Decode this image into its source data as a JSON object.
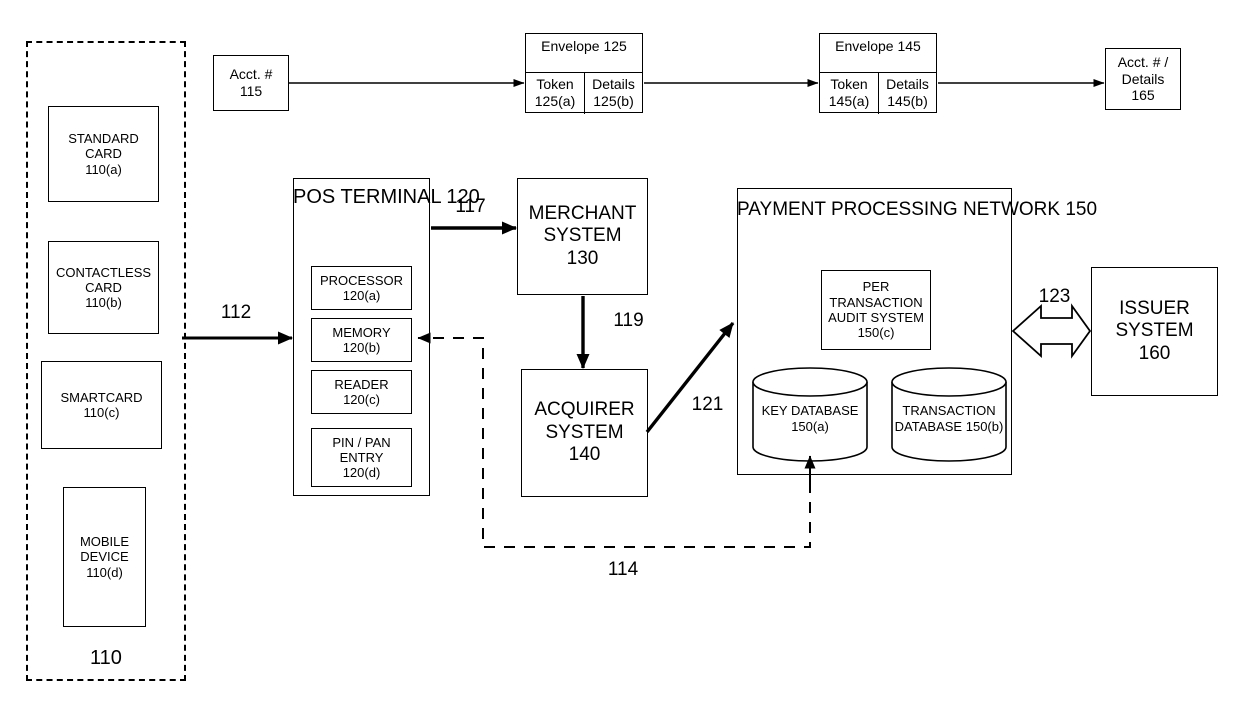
{
  "figure": {
    "group_110": {
      "label": "110",
      "items": [
        {
          "lines": [
            "STANDARD",
            "CARD",
            "110(a)"
          ]
        },
        {
          "lines": [
            "CONTACTLESS",
            "CARD",
            "110(b)"
          ]
        },
        {
          "lines": [
            "SMARTCARD",
            "110(c)"
          ]
        },
        {
          "lines": [
            "MOBILE",
            "DEVICE",
            "110(d)"
          ]
        }
      ]
    },
    "acct_start": {
      "lines": [
        "Acct. #",
        "115"
      ]
    },
    "envelope_125": {
      "title": "Envelope",
      "number": "125",
      "cells": [
        {
          "name": "Token",
          "ref": "125(a)"
        },
        {
          "name": "Details",
          "ref": "125(b)"
        }
      ]
    },
    "envelope_145": {
      "title": "Envelope",
      "number": "145",
      "cells": [
        {
          "name": "Token",
          "ref": "145(a)"
        },
        {
          "name": "Details",
          "ref": "145(b)"
        }
      ]
    },
    "acct_end": {
      "lines": [
        "Acct. # /",
        "Details",
        "165"
      ]
    },
    "pos_terminal": {
      "title_line1": "POS",
      "title_line2": "TERMINAL",
      "number": "120",
      "components": [
        {
          "name": "PROCESSOR",
          "ref": "120(a)"
        },
        {
          "name": "MEMORY",
          "ref": "120(b)"
        },
        {
          "name": "READER",
          "ref": "120(c)"
        },
        {
          "name": "PIN / PAN ENTRY",
          "name_line1": "PIN / PAN",
          "name_line2": "ENTRY",
          "ref": "120(d)"
        }
      ]
    },
    "merchant_system": {
      "line1": "MERCHANT",
      "line2": "SYSTEM",
      "number": "130"
    },
    "acquirer_system": {
      "line1": "ACQUIRER",
      "line2": "SYSTEM",
      "number": "140"
    },
    "payment_processing_network": {
      "line1": "PAYMENT PROCESSING",
      "line2": "NETWORK",
      "number": "150",
      "audit_system": {
        "line1": "PER",
        "line2": "TRANSACTION",
        "line3": "AUDIT SYSTEM",
        "ref": "150(c)"
      },
      "key_database": {
        "line1": "KEY",
        "line2": "DATABASE",
        "ref": "150(a)"
      },
      "transaction_database": {
        "line1": "TRANSACTION",
        "line2": "DATABASE",
        "ref": "150(b)"
      }
    },
    "issuer_system": {
      "line1": "ISSUER",
      "line2": "SYSTEM",
      "number": "160"
    },
    "connector_labels": {
      "c112": "112",
      "c114": "114",
      "c117": "117",
      "c119": "119",
      "c121": "121",
      "c123": "123"
    }
  },
  "colors": {
    "line": "#000000",
    "background": "#ffffff"
  }
}
